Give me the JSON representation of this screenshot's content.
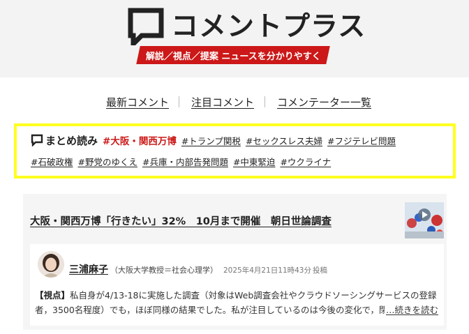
{
  "header": {
    "logo_text": "コメントプラス",
    "tagline": "解説／視点／提案 ニュースを分かりやすく"
  },
  "nav": {
    "items": [
      {
        "label": "最新コメント"
      },
      {
        "label": "注目コメント"
      },
      {
        "label": "コメンテーター一覧"
      }
    ]
  },
  "tags": {
    "title": "まとめ読み",
    "featured": "#大阪・関西万博",
    "line1": [
      "#トランプ関税",
      "#セックスレス夫婦",
      "#フジテレビ問題"
    ],
    "line2": [
      "#石破政権",
      "#野党のゆくえ",
      "#兵庫・内部告発問題",
      "#中東緊迫",
      "#ウクライナ"
    ]
  },
  "article": {
    "title": "大阪・関西万博「行きたい」32%　10月まで開催　朝日世論調査",
    "thumbnail_icon": "play-video-icon",
    "comment": {
      "author": "三浦麻子",
      "author_title": "（大阪大学教授＝社会心理学）",
      "date": "2025年4月21日11時43分",
      "post_label": "投稿",
      "lead": "【視点】",
      "text": "私自身が4/13-18に実施した調査（対象はWeb調査会社やクラウドソーシングサービスの登録者，3500名程度）でも，ほぼ同様の結果でした。私が注目しているのは今後の変化で，閉",
      "read_more": "…続きを読む"
    }
  },
  "colors": {
    "accent_red": "#cc1818",
    "highlight_yellow": "#ffff1f",
    "header_bg": "#f3f3f3",
    "card_bg": "#f5f5f5"
  }
}
